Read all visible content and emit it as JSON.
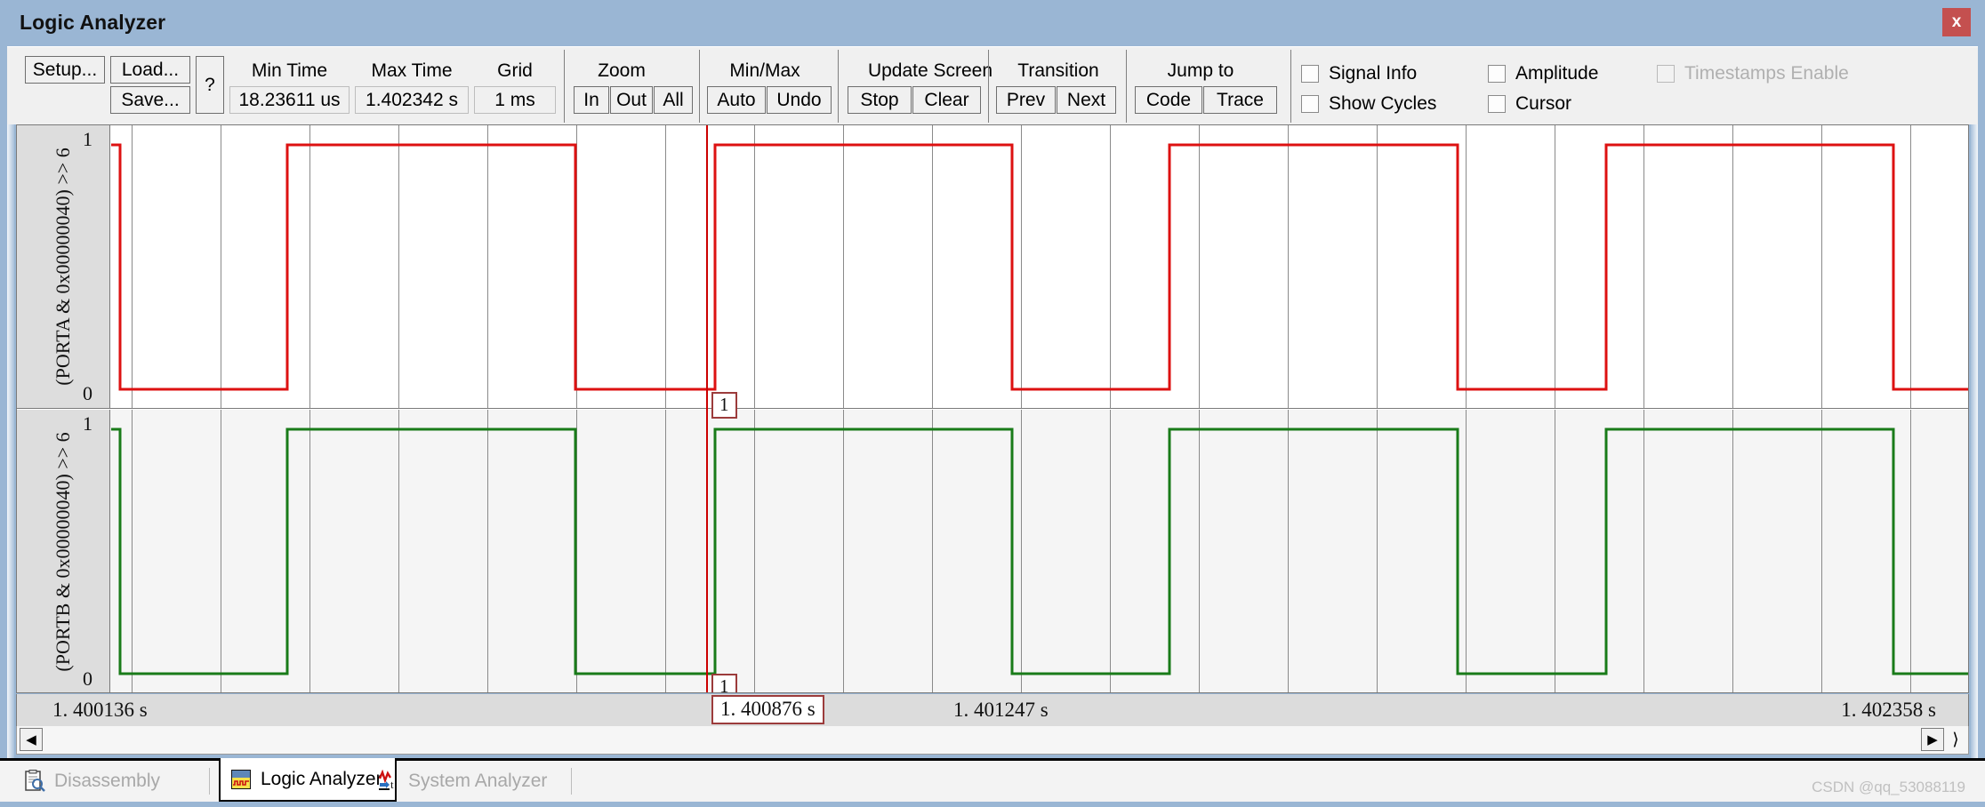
{
  "window": {
    "title": "Logic Analyzer",
    "close_label": "x",
    "close_icon": "close-icon",
    "titlebar_color": "#9ab6d4",
    "close_color": "#c4504f"
  },
  "toolbar": {
    "setup_label": "Setup...",
    "load_label": "Load...",
    "save_label": "Save...",
    "help_label": "?",
    "min_time": {
      "label": "Min Time",
      "value": "18.23611 us"
    },
    "max_time": {
      "label": "Max Time",
      "value": "1.402342 s"
    },
    "grid": {
      "label": "Grid",
      "value": "1 ms"
    },
    "zoom": {
      "label": "Zoom",
      "buttons": [
        "In",
        "Out",
        "All"
      ]
    },
    "minmax": {
      "label": "Min/Max",
      "buttons": [
        "Auto",
        "Undo"
      ]
    },
    "update": {
      "label": "Update Screen",
      "buttons": [
        "Stop",
        "Clear"
      ]
    },
    "transition": {
      "label": "Transition",
      "buttons": [
        "Prev",
        "Next"
      ]
    },
    "jumpto": {
      "label": "Jump to",
      "buttons": [
        "Code",
        "Trace"
      ]
    },
    "checkboxes": [
      {
        "label": "Signal Info",
        "checked": false,
        "enabled": true
      },
      {
        "label": "Amplitude",
        "checked": false,
        "enabled": true
      },
      {
        "label": "Timestamps Enable",
        "checked": false,
        "enabled": false
      },
      {
        "label": "Show Cycles",
        "checked": false,
        "enabled": true
      },
      {
        "label": "Cursor",
        "checked": false,
        "enabled": true
      }
    ]
  },
  "chart_data": {
    "type": "line",
    "title": "Logic Analyzer",
    "xlabel": "",
    "ylabel": "",
    "grid": true,
    "legend": "none",
    "xlim": [
      1.400136,
      1.402358
    ],
    "ylim": [
      0,
      1
    ],
    "x_tick_labels": [
      "1. 400136  s",
      "1. 400876  s",
      "1. 401247  s",
      "1. 402358  s"
    ],
    "y_tick_labels": [
      "1",
      "0"
    ],
    "grid_interval_s": 0.0001,
    "cursor": {
      "index": "1",
      "time": "1. 400876  s",
      "x_fraction": 0.3205,
      "color": "#cc0000"
    },
    "series": [
      {
        "name": "(PORTA & 0x00000040) >> 6",
        "color": "#dd1111",
        "type": "digital",
        "initial_level": 1,
        "transitions_fraction": [
          0.005,
          0.095,
          0.25,
          0.325,
          0.485,
          0.57,
          0.725,
          0.805,
          0.96
        ]
      },
      {
        "name": "(PORTB & 0x00000040) >> 6",
        "color": "#197b19",
        "type": "digital",
        "initial_level": 1,
        "transitions_fraction": [
          0.005,
          0.095,
          0.25,
          0.325,
          0.485,
          0.57,
          0.725,
          0.805,
          0.96
        ]
      }
    ]
  },
  "scrollbar": {
    "left_arrow": "◀",
    "right_arrow": "▶",
    "right_end": "⟩"
  },
  "tabs": [
    {
      "label": "Disassembly",
      "icon": "disassembly-icon",
      "active": false
    },
    {
      "label": "Logic Analyzer",
      "icon": "logic-analyzer-icon",
      "active": true
    },
    {
      "label": "System Analyzer",
      "icon": "system-analyzer-icon",
      "active": false
    }
  ],
  "watermark": "CSDN @qq_53088119"
}
